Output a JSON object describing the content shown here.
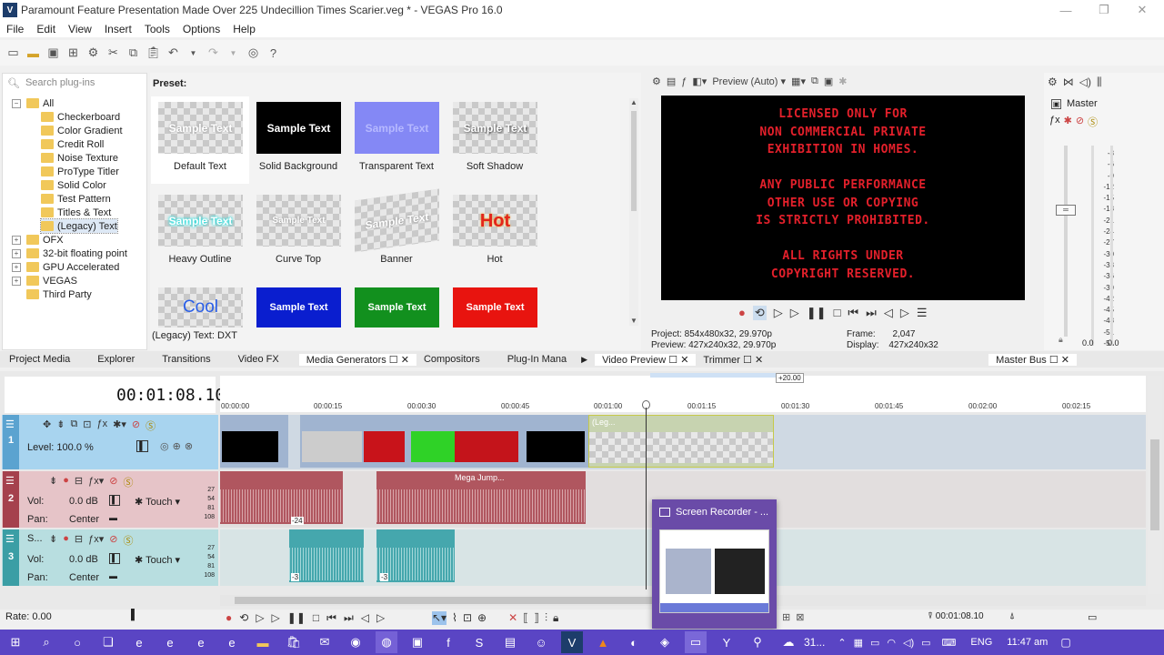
{
  "window": {
    "title": "Paramount Feature Presentation Made Over 225 Undecillion Times Scarier.veg * - VEGAS Pro 16.0",
    "logo": "V",
    "controls": [
      "—",
      "❐",
      "✕"
    ]
  },
  "menu": [
    "File",
    "Edit",
    "View",
    "Insert",
    "Tools",
    "Options",
    "Help"
  ],
  "plugins": {
    "search_placeholder": "Search plug-ins",
    "tree": [
      {
        "label": "All",
        "level": 1
      },
      {
        "label": "Checkerboard",
        "level": 2
      },
      {
        "label": "Color Gradient",
        "level": 2
      },
      {
        "label": "Credit Roll",
        "level": 2
      },
      {
        "label": "Noise Texture",
        "level": 2
      },
      {
        "label": "ProType Titler",
        "level": 2
      },
      {
        "label": "Solid Color",
        "level": 2
      },
      {
        "label": "Test Pattern",
        "level": 2
      },
      {
        "label": "Titles & Text",
        "level": 2
      },
      {
        "label": "(Legacy) Text",
        "level": 2
      },
      {
        "label": "OFX",
        "level": 1
      },
      {
        "label": "32-bit floating point",
        "level": 1
      },
      {
        "label": "GPU Accelerated",
        "level": 1
      },
      {
        "label": "VEGAS",
        "level": 1
      },
      {
        "label": "Third Party",
        "level": 1
      }
    ]
  },
  "presets": {
    "label": "Preset:",
    "status": "(Legacy) Text: DXT",
    "items": [
      {
        "name": "Default Text",
        "thumb_text": "Sample Text"
      },
      {
        "name": "Solid Background",
        "thumb_text": "Sample Text"
      },
      {
        "name": "Transparent Text",
        "thumb_text": "Sample Text"
      },
      {
        "name": "Soft Shadow",
        "thumb_text": "Sample Text"
      },
      {
        "name": "Heavy Outline",
        "thumb_text": "Sample Text"
      },
      {
        "name": "Curve Top",
        "thumb_text": "Sample Text"
      },
      {
        "name": "Banner",
        "thumb_text": "Sample Text"
      },
      {
        "name": "Hot",
        "thumb_text": "Hot"
      },
      {
        "name": "",
        "thumb_text": "Cool"
      },
      {
        "name": "",
        "thumb_text": "Sample Text"
      },
      {
        "name": "",
        "thumb_text": "Sample Text"
      },
      {
        "name": "",
        "thumb_text": "Sample Text"
      }
    ]
  },
  "preview": {
    "mode": "Preview (Auto)",
    "lines": [
      "LICENSED ONLY FOR",
      "NON COMMERCIAL PRIVATE",
      "EXHIBITION IN HOMES.",
      "",
      "ANY PUBLIC PERFORMANCE",
      "OTHER USE OR COPYING",
      "IS STRICTLY PROHIBITED.",
      "",
      "ALL RIGHTS UNDER",
      "COPYRIGHT RESERVED."
    ],
    "project": "Project:  854x480x32, 29.970p",
    "preview": "Preview:  427x240x32, 29.970p",
    "frame_label": "Frame:",
    "frame": "2,047",
    "display_label": "Display:",
    "display": "427x240x32"
  },
  "master": {
    "label": "Master",
    "scale": [
      "3",
      "6",
      "9",
      "12",
      "15",
      "18",
      "21",
      "24",
      "27",
      "30",
      "33",
      "36",
      "39",
      "42",
      "45",
      "48",
      "51",
      "54",
      "57"
    ],
    "left_value": "0.0",
    "right_value": "0.0"
  },
  "tabs": [
    "Project Media",
    "Explorer",
    "Transitions",
    "Video FX",
    "Media Generators",
    "Compositors",
    "Plug-In Mana"
  ],
  "right_tabs": [
    "Video Preview",
    "Trimmer",
    "Master Bus"
  ],
  "timeline": {
    "time": "00:01:08.10",
    "offset": "+20.00",
    "ruler": [
      "00:00:00",
      "00:00:15",
      "00:00:30",
      "00:00:45",
      "00:01:00",
      "00:01:15",
      "00:01:30",
      "00:01:45",
      "00:02:00",
      "00:02:15"
    ],
    "tracks": [
      {
        "num": "1",
        "level": "Level: 100.0 %"
      },
      {
        "num": "2",
        "vol_label": "Vol:",
        "vol": "0.0 dB",
        "pan_label": "Pan:",
        "pan": "Center",
        "touch": "Touch"
      },
      {
        "num": "3",
        "name": "S...",
        "vol_label": "Vol:",
        "vol": "0.0 dB",
        "pan_label": "Pan:",
        "pan": "Center",
        "touch": "Touch"
      }
    ],
    "clip_labels": {
      "legacy": "(Leg...",
      "mega": "Mega Jump...",
      "neg24": "-24",
      "neg3a": "-3",
      "neg3b": "-3"
    },
    "meter_ticks": [
      "27",
      "54",
      "81",
      "108"
    ],
    "rate": "Rate: 0.00",
    "bottom_time": "00:01:08.10"
  },
  "recorder": {
    "title": "Screen Recorder - ...",
    "close": "..."
  },
  "taskbar": {
    "temp": "31...",
    "lang": "ENG",
    "time": "11:47 am"
  }
}
